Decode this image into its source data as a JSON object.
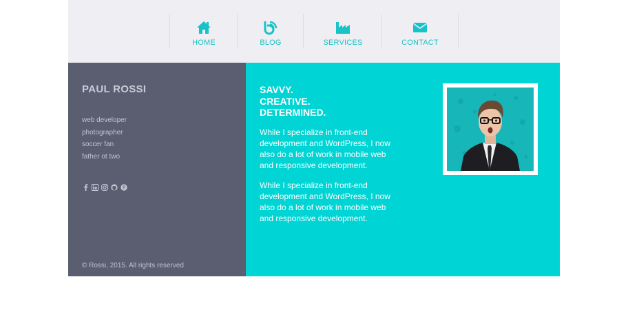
{
  "nav": {
    "items": [
      {
        "label": "HOME",
        "icon": "home-icon"
      },
      {
        "label": "BLOG",
        "icon": "blog-icon"
      },
      {
        "label": "SERVICES",
        "icon": "factory-icon"
      },
      {
        "label": "CONTACT",
        "icon": "envelope-icon"
      }
    ]
  },
  "sidebar": {
    "name": "PAUL ROSSI",
    "roles": [
      "web developer",
      "photographer",
      "soccer fan",
      "father ot two"
    ],
    "socials": [
      "facebook-icon",
      "linkedin-icon",
      "instagram-icon",
      "github-icon",
      "pinterest-icon"
    ],
    "copyright": "© Rossi, 2015. All rights reserved"
  },
  "main": {
    "headline": [
      "SAVVY.",
      "CREATIVE.",
      "DETERMINED."
    ],
    "paragraphs": [
      "While I specialize in front-end development and WordPress, I now also do a lot of work in mobile web and responsive development.",
      "While I specialize in front-end development and WordPress, I now also do a lot of work in mobile web and responsive development."
    ]
  },
  "colors": {
    "accent": "#00d4d4",
    "nav_text": "#17c3c8",
    "sidebar_bg": "#5a5e70",
    "nav_bg": "#efeff3"
  }
}
